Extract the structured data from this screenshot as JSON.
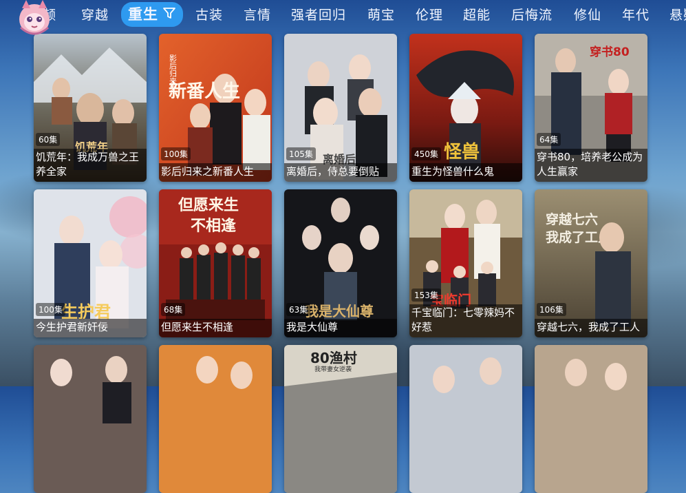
{
  "app": {
    "avatar_icon": "cartoon-avatar-icon",
    "accent": "#2e9af0"
  },
  "tabs": [
    {
      "label": "频",
      "active": false
    },
    {
      "label": "穿越",
      "active": false
    },
    {
      "label": "重生",
      "active": true
    },
    {
      "label": "古装",
      "active": false
    },
    {
      "label": "言情",
      "active": false
    },
    {
      "label": "强者回归",
      "active": false
    },
    {
      "label": "萌宝",
      "active": false
    },
    {
      "label": "伦理",
      "active": false
    },
    {
      "label": "超能",
      "active": false
    },
    {
      "label": "后悔流",
      "active": false
    },
    {
      "label": "修仙",
      "active": false
    },
    {
      "label": "年代",
      "active": false
    },
    {
      "label": "悬疑",
      "active": false
    }
  ],
  "filter_icon": "filter-icon",
  "dramas": [
    {
      "episodes": "60集",
      "title": "饥荒年：我成万兽之王养全家"
    },
    {
      "episodes": "100集",
      "title": "影后归来之新番人生"
    },
    {
      "episodes": "105集",
      "title": "离婚后，侍总要倒贴"
    },
    {
      "episodes": "450集",
      "title": "重生为怪兽什么鬼"
    },
    {
      "episodes": "64集",
      "title": "穿书80，培养老公成为人生赢家"
    },
    {
      "episodes": "100集",
      "title": "今生护君新奸佞"
    },
    {
      "episodes": "68集",
      "title": "但愿来生不相逢"
    },
    {
      "episodes": "63集",
      "title": "我是大仙尊"
    },
    {
      "episodes": "153集",
      "title": "千宝临门：七零辣妈不好惹"
    },
    {
      "episodes": "106集",
      "title": "穿越七六，我成了工人"
    },
    {
      "episodes": "",
      "title": ""
    },
    {
      "episodes": "",
      "title": ""
    },
    {
      "episodes": "",
      "title": ""
    },
    {
      "episodes": "",
      "title": ""
    },
    {
      "episodes": "",
      "title": ""
    }
  ],
  "poster_text": {
    "p1": "饥荒年",
    "p2": "新番人生",
    "p2b": "影后归来之",
    "p3": "离婚后",
    "p4": "怪兽",
    "p5": "穿书80",
    "p6": "生护君",
    "p7a": "但愿来生",
    "p7b": "不相逢",
    "p8": "我是大仙尊",
    "p9": "宝临门",
    "p10a": "穿越七六",
    "p10b": "我成了工人",
    "p13": "80渔村",
    "p13b": "我带妻女逆袭"
  }
}
